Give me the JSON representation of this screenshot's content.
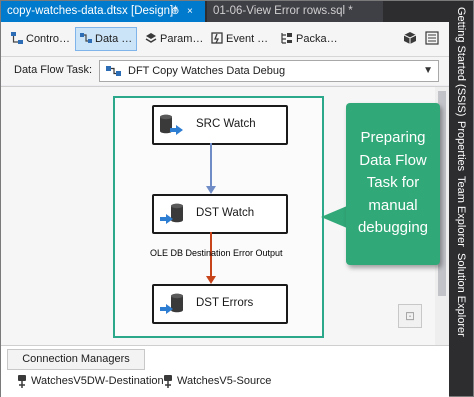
{
  "tabs": [
    {
      "label": "copy-watches-data.dtsx [Design]*",
      "active": true
    },
    {
      "label": "01-06-View Error rows.sql *",
      "active": false
    }
  ],
  "tab_glyphs": {
    "pin": "⊕",
    "close": "×"
  },
  "toolbar": {
    "items": [
      {
        "label": "Contro…",
        "icon": "control-flow-icon",
        "selected": false
      },
      {
        "label": "Data …",
        "icon": "data-flow-icon",
        "selected": true
      },
      {
        "label": "Param…",
        "icon": "parameters-icon",
        "selected": false
      },
      {
        "label": "Event …",
        "icon": "event-handlers-icon",
        "selected": false
      },
      {
        "label": "Packa…",
        "icon": "package-explorer-icon",
        "selected": false
      }
    ]
  },
  "dataflow_task": {
    "label": "Data Flow Task:",
    "selected": "DFT Copy Watches Data Debug",
    "icon": "data-flow-task-icon"
  },
  "components": {
    "source": {
      "label": "SRC Watch",
      "icon": "source-db-icon"
    },
    "destination": {
      "label": "DST Watch",
      "icon": "destination-db-icon"
    },
    "errors": {
      "label": "DST Errors",
      "icon": "destination-db-icon"
    }
  },
  "paths": {
    "normal_color": "#6f8cc7",
    "error_color": "#c7431a",
    "error_label": "OLE DB Destination Error Output"
  },
  "callout": {
    "lines": [
      "Preparing",
      "Data Flow",
      "Task for",
      "manual",
      "debugging"
    ],
    "color": "#30a878"
  },
  "connection_managers": {
    "tab_label": "Connection Managers",
    "items": [
      "WatchesV5DW-Destination",
      "WatchesV5-Source"
    ]
  },
  "side_tabs": [
    "Getting Started (SSIS)",
    "Properties",
    "Team Explorer",
    "Solution Explorer"
  ],
  "colors": {
    "accent": "#007acc",
    "highlight_border": "#2aa889"
  }
}
